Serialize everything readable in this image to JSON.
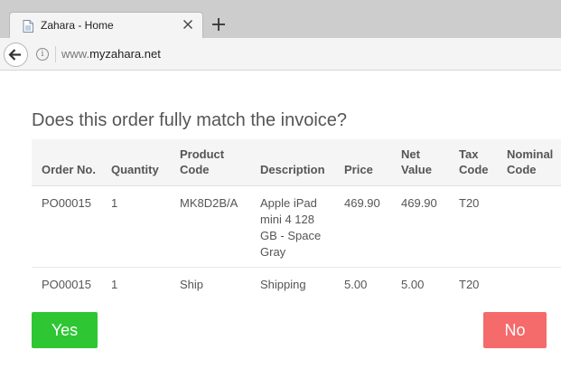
{
  "browser": {
    "tab_title": "Zahara - Home",
    "url_prefix": "www.",
    "url_host": "myzahara.net"
  },
  "page": {
    "question": "Does this order fully match the invoice?",
    "yes_label": "Yes",
    "no_label": "No",
    "colors": {
      "yes": "#2ec733",
      "no": "#f56a6a"
    }
  },
  "table": {
    "headers": [
      "Order No.",
      "Quantity",
      "Product Code",
      "Description",
      "Price",
      "Net Value",
      "Tax Code",
      "Nominal Code"
    ],
    "rows": [
      [
        "PO00015",
        "1",
        "MK8D2B/A",
        "Apple iPad mini 4 128 GB - Space Gray",
        "469.90",
        "469.90",
        "T20",
        ""
      ],
      [
        "PO00015",
        "1",
        "Ship",
        "Shipping",
        "5.00",
        "5.00",
        "T20",
        ""
      ]
    ]
  }
}
